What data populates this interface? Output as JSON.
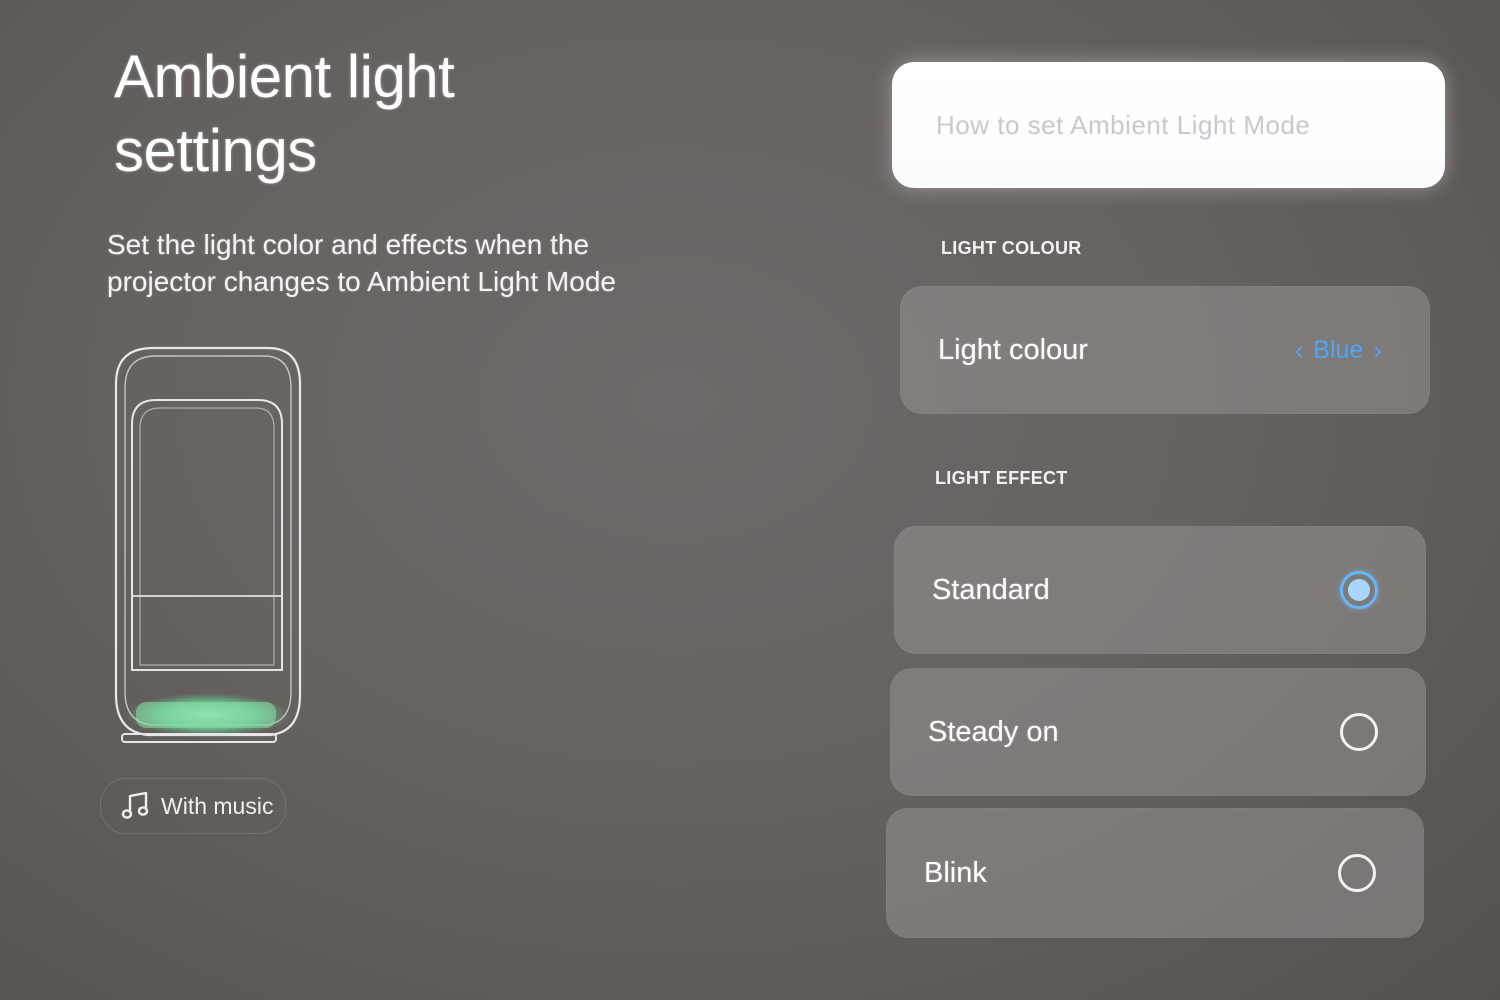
{
  "header": {
    "title": "Ambient light settings",
    "description": "Set the light color and effects when the projector changes to Ambient Light Mode"
  },
  "illustration": {
    "glow_color": "#7fe0a6"
  },
  "music_chip": {
    "icon": "music-note-icon",
    "label": "With music"
  },
  "search": {
    "placeholder": "How to set Ambient Light Mode",
    "value": ""
  },
  "light_colour_section": {
    "heading": "LIGHT COLOUR",
    "item": {
      "label": "Light colour",
      "value": "Blue",
      "prev_icon": "chevron-left-icon",
      "next_icon": "chevron-right-icon"
    }
  },
  "light_effect_section": {
    "heading": "LIGHT EFFECT",
    "options": [
      {
        "label": "Standard",
        "selected": true
      },
      {
        "label": "Steady on",
        "selected": false
      },
      {
        "label": "Blink",
        "selected": false
      }
    ]
  },
  "colors": {
    "accent": "#4da4ff",
    "background": "#676260",
    "card": "#8b8785"
  }
}
